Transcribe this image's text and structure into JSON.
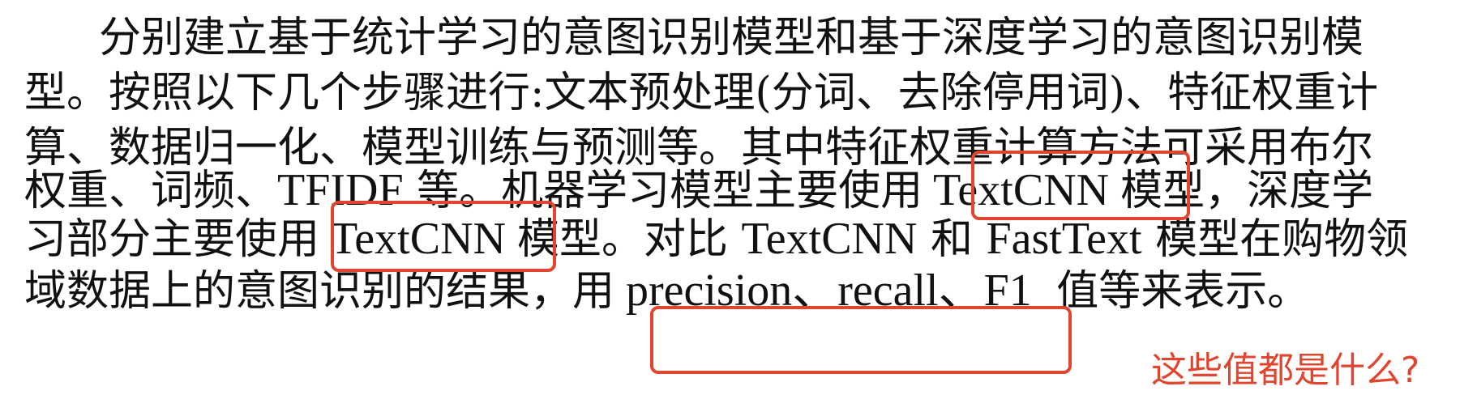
{
  "paragraph": {
    "line1": "分别建立基于统计学习的意图识别模型和基于深度学习的意图识别模",
    "line2": "型。按照以下几个步骤进行:文本预处理(分词、去除停用词)、特征权重计",
    "line3": "算、数据归一化、模型训练与预测等。其中特征权重计算方法可采用布尔",
    "line4": {
      "before": "权重、词频、",
      "tfidf": "TFIDF",
      "middle": " 等。机器学习模型主要使用",
      "highlight": " TextCNN ",
      "after": "模型，深度学"
    },
    "line5": {
      "before": "习部分主要使用",
      "highlight": " TextCNN ",
      "middle": "模型。对比 ",
      "textcnn": "TextCNN",
      "and": " 和 ",
      "fasttext": "FastText",
      "after": " 模型在购物领"
    },
    "line6": {
      "before": "域数据上的意图识别的结果，用",
      "highlight": " precision、recall、F1 ",
      "after": " 值等来表示。"
    }
  },
  "annotation": {
    "question": "这些值都是什么?"
  },
  "colors": {
    "text": "#111111",
    "highlight_border": "#e0462f",
    "annotation": "#e0462f"
  }
}
